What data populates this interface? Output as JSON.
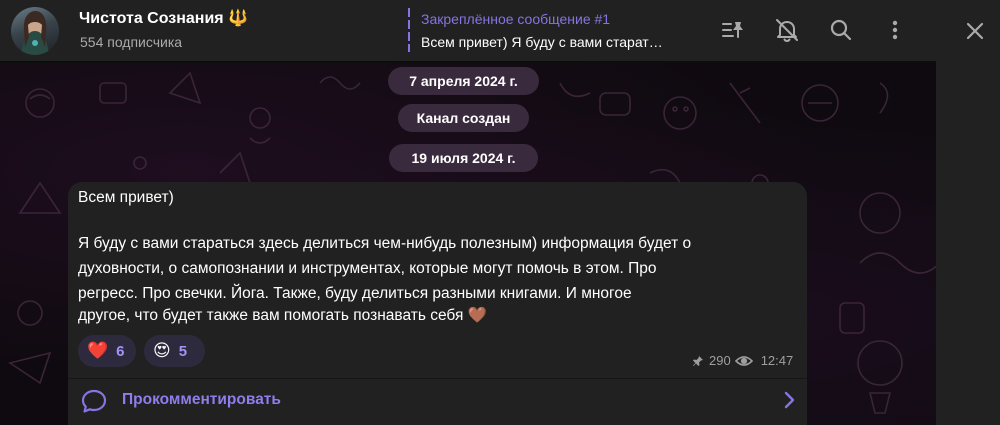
{
  "header": {
    "channel_name": "Чистота Сознания 🔱",
    "subscribers": "554 подписчика",
    "pinned_title": "Закреплённое сообщение #1",
    "pinned_text": "Всем привет) Я буду с вами старат…"
  },
  "icons": {
    "pin_list": "pinned-list-icon",
    "mute": "bell-off-icon",
    "search": "search-icon",
    "more": "more-vertical-icon",
    "close": "close-icon",
    "comment": "comment-icon",
    "chevron": "chevron-right-icon",
    "views_eye": "eye-icon",
    "pin_small": "pin-icon"
  },
  "service": {
    "date1": "7 апреля 2024 г.",
    "created": "Канал создан",
    "date2": "19 июля 2024 г."
  },
  "message": {
    "line1": "Всем привет)",
    "line2": "Я буду с вами стараться здесь делиться чем-нибудь полезным) информация будет о",
    "line3": "духовности, о самопознании и инструментах, которые могут помочь в этом. Про",
    "line4": "регресс. Про свечки. Йога. Также, буду делиться разными книгами. И многое",
    "line5": "другое, что будет также вам помогать познавать себя 🤎",
    "reactions": [
      {
        "emoji": "❤️",
        "count": "6"
      },
      {
        "emoji": "😍",
        "count": "5"
      }
    ],
    "views": "290",
    "time": "12:47",
    "comment_label": "Прокомментировать"
  },
  "colors": {
    "accent": "#8774e1",
    "header_bg": "#212121",
    "bubble_bg": "#212121",
    "pill_bg": "#3a2a3e"
  }
}
